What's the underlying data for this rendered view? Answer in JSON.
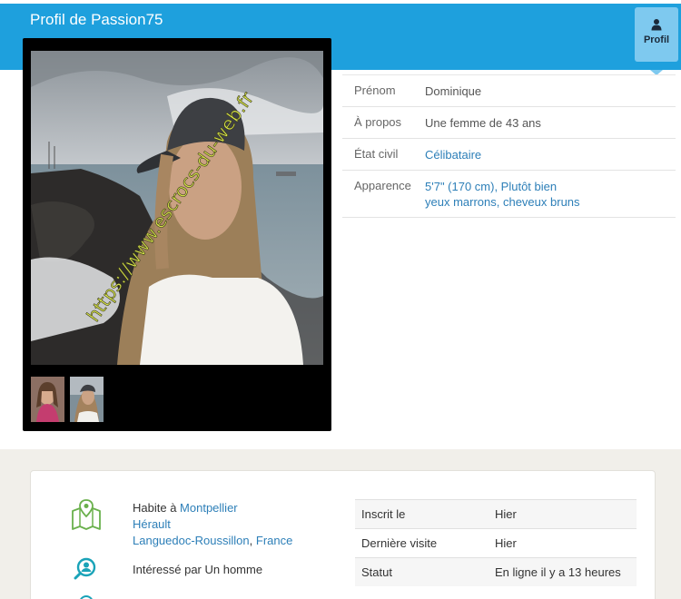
{
  "header": {
    "title": "Profil de Passion75",
    "profile_button_label": "Profil",
    "profile_icon": "user-icon",
    "bg_color": "#1ea0dd"
  },
  "photo": {
    "watermark": "https://www.escrocs-du-web.fr",
    "thumbnails_count": 2
  },
  "info": {
    "rows": [
      {
        "label": "Prénom",
        "value": "Dominique"
      },
      {
        "label": "À propos",
        "value": "Une femme de 43 ans"
      },
      {
        "label": "État civil",
        "value": "Célibataire"
      },
      {
        "label": "Apparence",
        "value_line1": "5'7\" (170 cm), Plutôt bien",
        "value_line2": "yeux marrons, cheveux bruns"
      }
    ]
  },
  "location": {
    "lives_prefix": "Habite à",
    "city": "Montpellier",
    "department": "Hérault",
    "region": "Languedoc-Roussillon",
    "separator": ",",
    "country": "France",
    "icon": "map-pin-icon"
  },
  "interest": {
    "text": "Intéressé par Un homme",
    "icon": "search-person-icon"
  },
  "stats": {
    "rows": [
      {
        "label": "Inscrit le",
        "value": "Hier"
      },
      {
        "label": "Dernière visite",
        "value": "Hier"
      },
      {
        "label": "Statut",
        "value": "En ligne il y a 13 heures"
      }
    ]
  },
  "colors": {
    "link": "#2d7fb8",
    "header": "#1ea0dd",
    "profile_button": "#7ec9ef",
    "icon_green": "#6ab04c",
    "icon_teal": "#1aa3b8"
  }
}
